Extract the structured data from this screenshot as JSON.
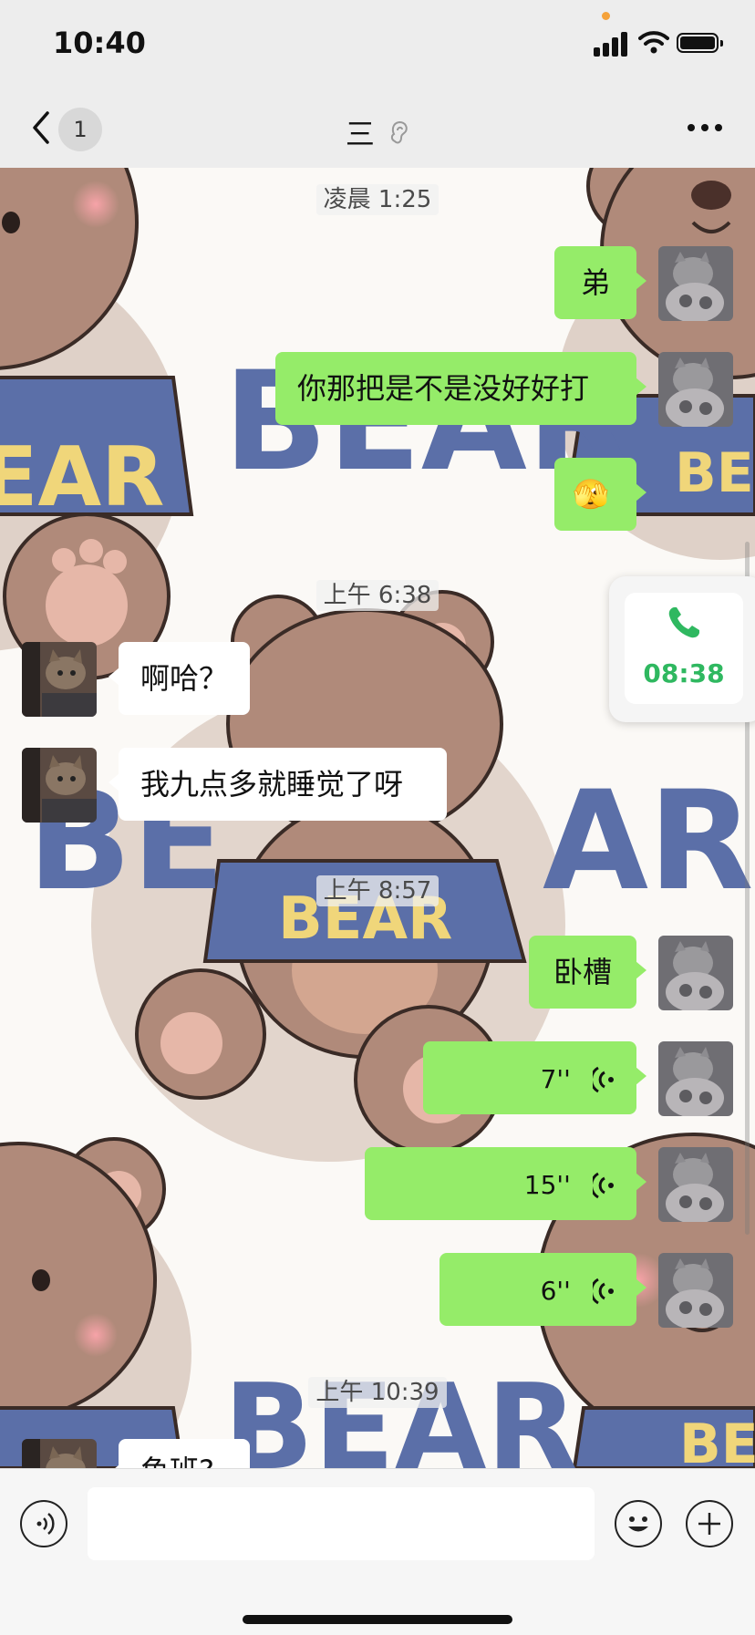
{
  "status_bar": {
    "time": "10:40",
    "battery_level": 1.0
  },
  "nav": {
    "back_badge": "1",
    "title": "三"
  },
  "chat": {
    "timestamps": [
      "凌晨 1:25",
      "上午 6:38",
      "上午 8:57",
      "上午 10:39"
    ],
    "messages": [
      {
        "side": "me",
        "type": "text",
        "text": "弟"
      },
      {
        "side": "me",
        "type": "text",
        "text": "你那把是不是没好好打"
      },
      {
        "side": "me",
        "type": "emoji",
        "text": "🫣"
      },
      {
        "side": "them",
        "type": "text",
        "text": "啊哈？"
      },
      {
        "side": "them",
        "type": "text",
        "text": "我九点多就睡觉了呀"
      },
      {
        "side": "me",
        "type": "text",
        "text": "卧槽"
      },
      {
        "side": "me",
        "type": "voice",
        "text": "7''"
      },
      {
        "side": "me",
        "type": "voice",
        "text": "15''"
      },
      {
        "side": "me",
        "type": "voice",
        "text": "6''"
      },
      {
        "side": "them",
        "type": "text",
        "text": "鱼班?"
      }
    ]
  },
  "call_widget": {
    "duration": "08:38",
    "icon": "phone-icon"
  },
  "wallpaper": {
    "text": "BEAR"
  },
  "input_bar": {
    "left_icon": "voice-mode-icon",
    "right_icons": [
      "emoji-icon",
      "plus-icon"
    ]
  },
  "colors": {
    "my_bubble": "#95ec69",
    "their_bubble": "#ffffff",
    "call_green": "#2fb860",
    "bear_blue": "#5b6fa8",
    "bear_brown": "#b08a7a"
  }
}
